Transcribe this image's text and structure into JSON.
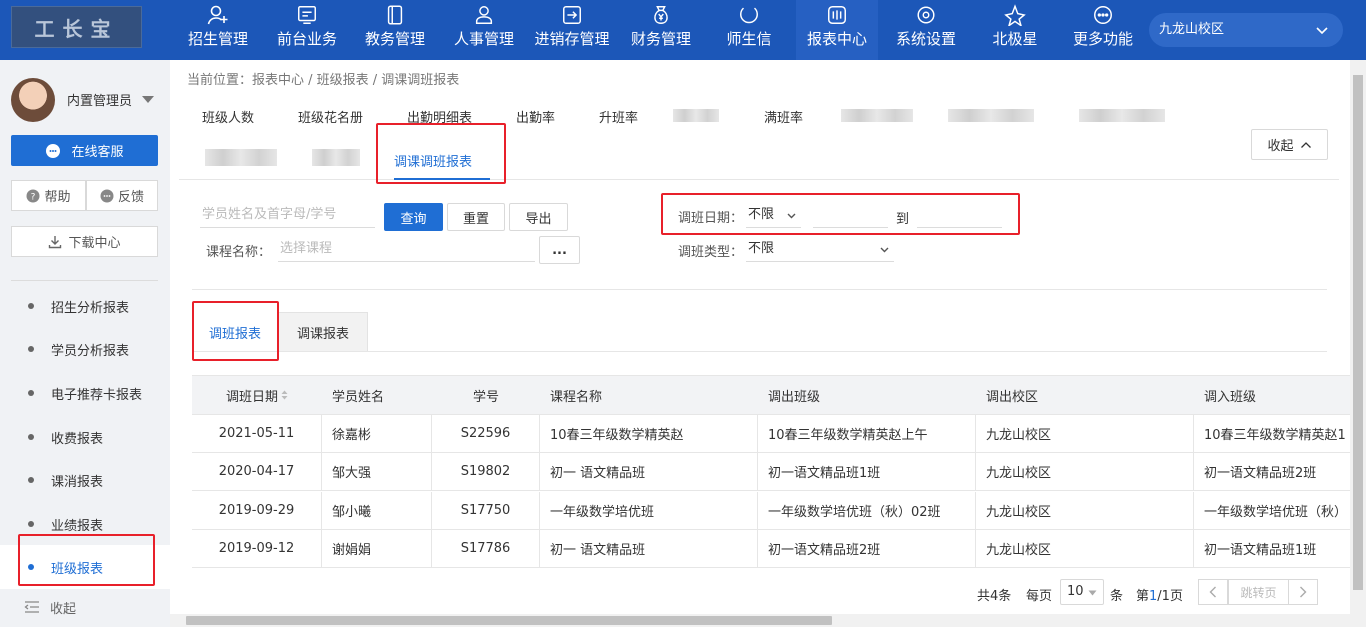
{
  "logo_text": "工长宝",
  "nav": [
    {
      "label": "招生管理",
      "icon": "person-add-icon"
    },
    {
      "label": "前台业务",
      "icon": "monitor-icon"
    },
    {
      "label": "教务管理",
      "icon": "book-icon"
    },
    {
      "label": "人事管理",
      "icon": "person-icon"
    },
    {
      "label": "进销存管理",
      "icon": "inventory-icon"
    },
    {
      "label": "财务管理",
      "icon": "money-bag-icon"
    },
    {
      "label": "师生信",
      "icon": "chat-icon"
    },
    {
      "label": "报表中心",
      "icon": "bar-chart-icon"
    },
    {
      "label": "系统设置",
      "icon": "gear-icon"
    },
    {
      "label": "北极星",
      "icon": "star-icon"
    },
    {
      "label": "更多功能",
      "icon": "more-icon"
    }
  ],
  "campus": "九龙山校区",
  "sidebar": {
    "username": "内置管理员",
    "online_service": "在线客服",
    "help": "帮助",
    "feedback": "反馈",
    "download_center": "下载中心",
    "items": [
      {
        "label": "招生分析报表"
      },
      {
        "label": "学员分析报表"
      },
      {
        "label": "电子推荐卡报表"
      },
      {
        "label": "收费报表"
      },
      {
        "label": "课消报表"
      },
      {
        "label": "业绩报表"
      },
      {
        "label": "班级报表"
      }
    ],
    "collapse": "收起"
  },
  "breadcrumb": "当前位置：报表中心 / 班级报表 / 调课调班报表",
  "report_tabs": {
    "class_count": "班级人数",
    "roster": "班级花名册",
    "attendance_detail": "出勤明细表",
    "attendance_rate": "出勤率",
    "promotion_rate": "升班率",
    "full_rate": "满班率",
    "active": "调课调班报表",
    "collapse": "收起"
  },
  "filters": {
    "student_placeholder": "学员姓名及首字母/学号",
    "query": "查询",
    "reset": "重置",
    "export": "导出",
    "course_label": "课程名称：",
    "course_placeholder": "选择课程",
    "course_more": "...",
    "date_label": "调班日期：",
    "date_value": "不限",
    "date_to": "到",
    "type_label": "调班类型：",
    "type_value": "不限"
  },
  "subtabs": {
    "class_report": "调班报表",
    "lesson_report": "调课报表"
  },
  "table": {
    "headers": {
      "date": "调班日期",
      "name": "学员姓名",
      "id": "学号",
      "course": "课程名称",
      "out_class": "调出班级",
      "out_campus": "调出校区",
      "in_class": "调入班级"
    },
    "rows": [
      {
        "date": "2021-05-11",
        "name": "徐嘉彬",
        "id": "S22596",
        "course": "10春三年级数学精英赵",
        "out_class": "10春三年级数学精英赵上午",
        "out_campus": "九龙山校区",
        "in_class": "10春三年级数学精英赵1"
      },
      {
        "date": "2020-04-17",
        "name": "邹大强",
        "id": "S19802",
        "course": "初一 语文精品班",
        "out_class": "初一语文精品班1班",
        "out_campus": "九龙山校区",
        "in_class": "初一语文精品班2班"
      },
      {
        "date": "2019-09-29",
        "name": "邹小曦",
        "id": "S17750",
        "course": "一年级数学培优班",
        "out_class": "一年级数学培优班（秋）02班",
        "out_campus": "九龙山校区",
        "in_class": "一年级数学培优班（秋）"
      },
      {
        "date": "2019-09-12",
        "name": "谢娟娟",
        "id": "S17786",
        "course": "初一 语文精品班",
        "out_class": "初一语文精品班2班",
        "out_campus": "九龙山校区",
        "in_class": "初一语文精品班1班"
      }
    ]
  },
  "pagination": {
    "total": "共4条",
    "per_page_label": "每页",
    "per_page": "10",
    "unit": "条",
    "page_prefix": "第",
    "current_page": "1",
    "page_suffix": "/1页",
    "jump_placeholder": "跳转页"
  },
  "colors": {
    "nav_bg": "#1c57b8",
    "accent": "#1f6ed4",
    "highlight_box": "#e8202a"
  }
}
